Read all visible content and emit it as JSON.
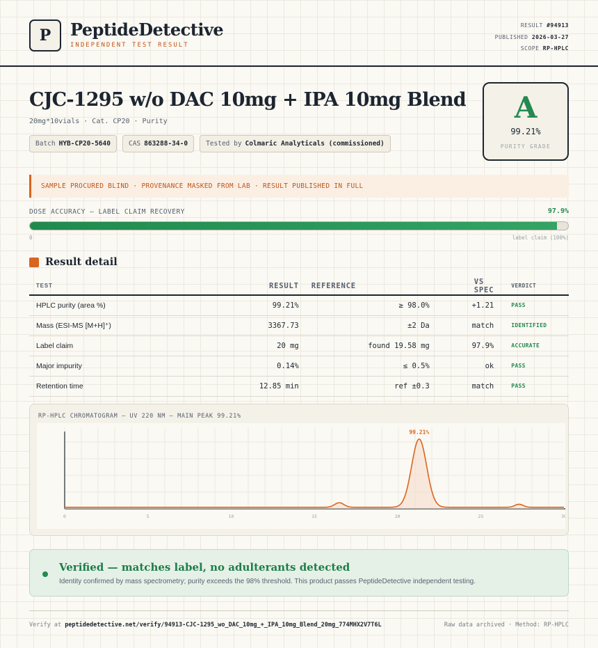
{
  "brand": {
    "logo_letter": "P",
    "name": "PeptideDetective",
    "tagline": "INDEPENDENT TEST RESULT"
  },
  "meta": {
    "result_label": "RESULT",
    "result_value": "#94913",
    "published_label": "PUBLISHED",
    "published_value": "2026-03-27",
    "scope_label": "SCOPE",
    "scope_value": "RP-HPLC"
  },
  "product": {
    "title": "CJC-1295 w/o DAC 10mg + IPA 10mg Blend",
    "subtitle": "20mg*10vials · Cat. CP20 · Purity",
    "chips": [
      {
        "label": "Batch",
        "value": "HYB-CP20-5640"
      },
      {
        "label": "CAS",
        "value": "863288-34-0"
      },
      {
        "label": "Tested by",
        "value": "Colmaric Analyticals (commissioned)"
      }
    ]
  },
  "grade": {
    "letter": "A",
    "value": "99.21%",
    "label": "PURITY GRADE",
    "color": "#238a52"
  },
  "banner": {
    "text": "SAMPLE PROCURED BLIND · PROVENANCE MASKED FROM LAB · RESULT PUBLISHED IN FULL"
  },
  "dose": {
    "label": "DOSE ACCURACY — LABEL CLAIM RECOVERY",
    "value": "97.9%",
    "fraction": 0.979,
    "min_label": "0",
    "max_label": "label claim (100%)"
  },
  "results": {
    "section_title": "Result detail",
    "columns": [
      "TEST",
      "RESULT",
      "REFERENCE",
      "VS SPEC",
      "VERDICT"
    ],
    "rows": [
      {
        "test": "HPLC purity (area %)",
        "result": "99.21%",
        "reference": "≥ 98.0%",
        "vs_spec": "+1.21",
        "verdict": "PASS"
      },
      {
        "test": "Mass (ESI-MS [M+H]⁺)",
        "result": "3367.73",
        "reference": "±2 Da",
        "vs_spec": "match",
        "verdict": "IDENTIFIED"
      },
      {
        "test": "Label claim",
        "result": "20 mg",
        "reference": "found 19.58 mg",
        "vs_spec": "97.9%",
        "verdict": "ACCURATE"
      },
      {
        "test": "Major impurity",
        "result": "0.14%",
        "reference": "≤ 0.5%",
        "vs_spec": "ok",
        "verdict": "PASS"
      },
      {
        "test": "Retention time",
        "result": "12.85 min",
        "reference": "ref ±0.3",
        "vs_spec": "match",
        "verdict": "PASS"
      }
    ]
  },
  "chromatogram": {
    "title": "RP-HPLC CHROMATOGRAM — UV 220 NM — MAIN PEAK 99.21%",
    "peak_label": "99.21%",
    "line_color": "#d9651f"
  },
  "chart_data": {
    "type": "line",
    "title": "RP-HPLC CHROMATOGRAM — UV 220 NM — MAIN PEAK 99.21%",
    "xlabel": "",
    "ylabel": "",
    "xlim": [
      0,
      30
    ],
    "ylim": [
      0,
      100
    ],
    "x_ticks": [
      "0",
      "5",
      "10",
      "15",
      "20",
      "25",
      "30"
    ],
    "peaks": [
      {
        "x": 16.5,
        "height": 6,
        "width": 0.28
      },
      {
        "x": 21.3,
        "height": 90,
        "width": 0.45
      },
      {
        "x": 27.3,
        "height": 4,
        "width": 0.25
      }
    ],
    "baseline": 2,
    "annotations": [
      {
        "x": 21.3,
        "text": "99.21%"
      }
    ],
    "grid": true
  },
  "verified": {
    "title": "Verified — matches label, no adulterants detected",
    "text": "Identity confirmed by mass spectrometry; purity exceeds the 98% threshold. This product passes PeptideDetective independent testing."
  },
  "footer": {
    "verify_prefix": "Verify at",
    "verify_url": "peptidedetective.net/verify/94913-CJC-1295_wo_DAC_10mg_+_IPA_10mg_Blend_20mg_774MHX2V7T6L",
    "right_text": "Raw data archived · Method: RP-HPLC"
  }
}
